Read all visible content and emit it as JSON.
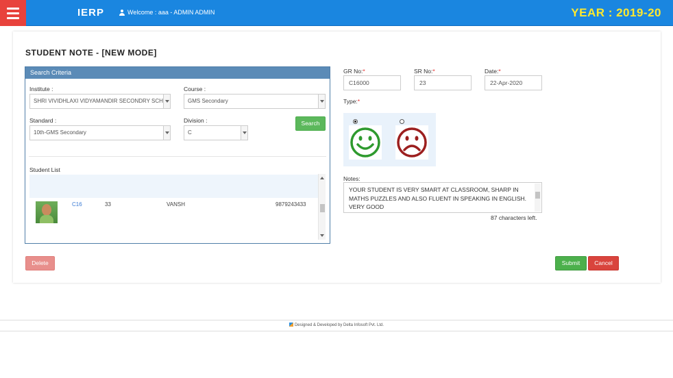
{
  "header": {
    "logo": "IERP",
    "welcome": "Welcome :  aaa - ADMIN ADMIN",
    "year": "YEAR : 2019-20"
  },
  "page": {
    "title": "STUDENT NOTE - [NEW MODE]"
  },
  "search_criteria": {
    "title": "Search Criteria",
    "institute_label": "Institute :",
    "institute_value": "SHRI VIVIDHLAXI VIDYAMANDIR SECONDRY SCHOOL",
    "course_label": "Course :",
    "course_value": "GMS Secondary",
    "standard_label": "Standard :",
    "standard_value": "10th-GMS Secondary",
    "division_label": "Division :",
    "division_value": "C",
    "search_button": "Search",
    "student_list_label": "Student List",
    "students": [
      {
        "gr": "C16",
        "roll": "33",
        "name": "VANSH",
        "phone": "9879243433"
      }
    ]
  },
  "form": {
    "gr_label": "GR No:",
    "gr_value": "C16000",
    "sr_label": "SR No:",
    "sr_value": "23",
    "date_label": "Date:",
    "date_value": "22-Apr-2020",
    "required_mark": "*",
    "type_label": "Type:",
    "type_selected": "happy",
    "notes_label": "Notes:",
    "notes_value": "YOUR STUDENT IS VERY SMART AT CLASSROOM, SHARP IN MATHS PUZZLES AND ALSO FLUENT IN SPEAKING IN ENGLISH. VERY GOOD",
    "chars_left": "87 characters left."
  },
  "buttons": {
    "delete": "Delete",
    "submit": "Submit",
    "cancel": "Cancel"
  },
  "footer": {
    "text": "Designed & Developed by Delta Infosoft Pvt. Ltd."
  },
  "colors": {
    "topbar": "#1a86e0",
    "menu_button": "#e8423c",
    "year_text": "#ffe92e",
    "happy_face": "#2e9a2e",
    "sad_face": "#9c1f1f"
  }
}
